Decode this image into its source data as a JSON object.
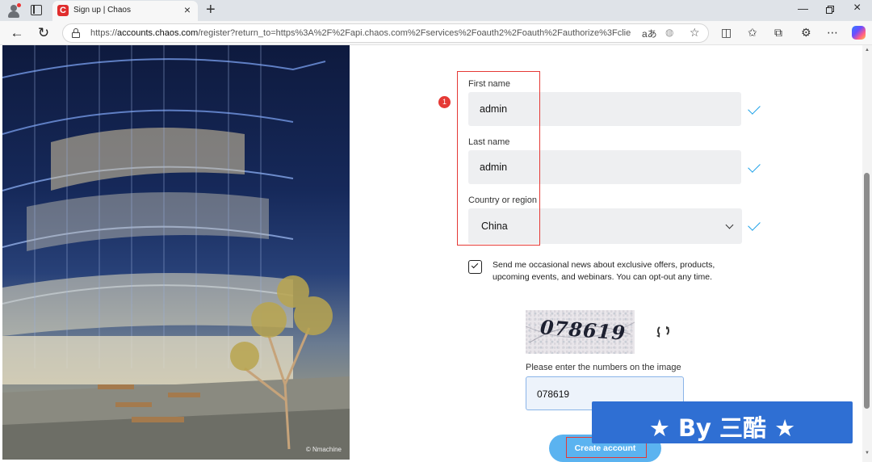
{
  "browser": {
    "tab_title": "Sign up | Chaos",
    "tab_favicon_letter": "C",
    "url_host": "accounts.chaos.com",
    "url_prefix": "https://",
    "url_rest": "/register?return_to=https%3A%2F%2Fapi.chaos.com%2Fservices%2Foauth2%2Foauth%2Fauthorize%3Fclient_id%3...",
    "read_aloud_icon": "aあ"
  },
  "form": {
    "first_name_label": "First name",
    "first_name_value": "admin",
    "last_name_label": "Last name",
    "last_name_value": "admin",
    "country_label": "Country or region",
    "country_value": "China",
    "newsletter_text": "Send me occasional news about exclusive offers, products, upcoming events, and webinars. You can opt-out any time.",
    "newsletter_checked": true,
    "captcha_code": "078619",
    "captcha_label": "Please enter the numbers on the image",
    "captcha_value": "078619",
    "submit_label": "Create account"
  },
  "hero": {
    "credit": "© Nmachine"
  },
  "annotation": {
    "badge": "1"
  },
  "watermark": {
    "text": "★ By 三酷 ★"
  },
  "colors": {
    "accent": "#1aa0e8",
    "button": "#5bb3f0",
    "highlight": "#e53935",
    "watermark": "#2f6fd3"
  }
}
